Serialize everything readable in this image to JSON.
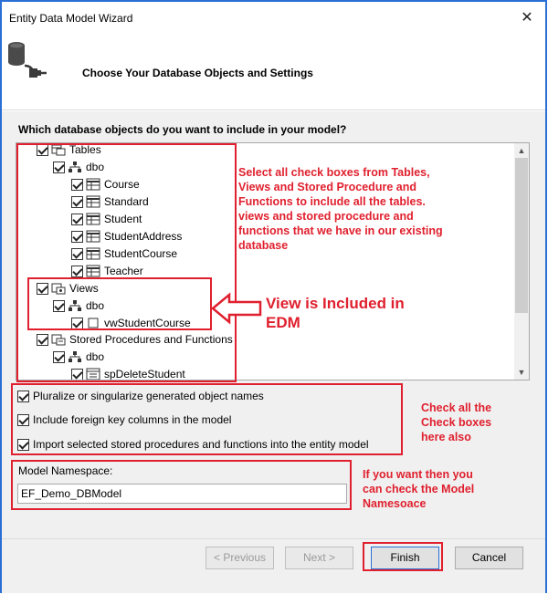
{
  "window": {
    "title": "Entity Data Model Wizard"
  },
  "header": {
    "title": "Choose Your Database Objects and Settings"
  },
  "question": "Which database objects do you want to include in your model?",
  "tree": {
    "items": [
      {
        "label": "Tables"
      },
      {
        "label": "dbo"
      },
      {
        "label": "Course"
      },
      {
        "label": "Standard"
      },
      {
        "label": "Student"
      },
      {
        "label": "StudentAddress"
      },
      {
        "label": "StudentCourse"
      },
      {
        "label": "Teacher"
      },
      {
        "label": "Views"
      },
      {
        "label": "dbo"
      },
      {
        "label": "vwStudentCourse"
      },
      {
        "label": "Stored Procedures and Functions"
      },
      {
        "label": "dbo"
      },
      {
        "label": "spDeleteStudent"
      }
    ]
  },
  "options": [
    {
      "label": "Pluralize or singularize generated object names",
      "checked": true
    },
    {
      "label": "Include foreign key columns in the model",
      "checked": true
    },
    {
      "label": "Import selected stored procedures and functions into the entity model",
      "checked": true
    }
  ],
  "namespace": {
    "label": "Model Namespace:",
    "value": "EF_Demo_DBModel"
  },
  "buttons": {
    "previous": "< Previous",
    "next": "Next >",
    "finish": "Finish",
    "cancel": "Cancel"
  },
  "annotations": {
    "tables": [
      "Select all check boxes from Tables,",
      "Views and Stored Procedure and",
      "Functions to include all the tables.",
      "views and stored procedure and",
      "functions that we have in our existing",
      "database"
    ],
    "views": [
      "View is Included in",
      "EDM"
    ],
    "options": [
      "Check all the",
      "Check boxes",
      "here also"
    ],
    "namespace": [
      "If you want then you",
      "can check the Model",
      "Namesoace"
    ]
  },
  "colors": {
    "annotation": "#e0202e",
    "window_border": "#2a6fd6",
    "dialog_bg": "#f0f0f0"
  }
}
